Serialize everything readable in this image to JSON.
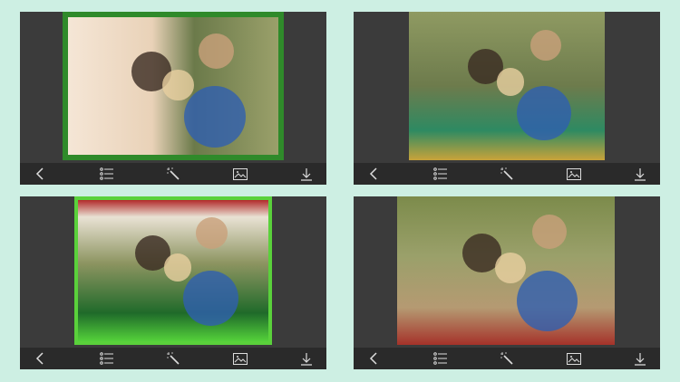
{
  "screens": [
    {
      "frame": "christmas-ornaments-tinsel-frame"
    },
    {
      "frame": "christmas-baubles-overlay"
    },
    {
      "frame": "green-ribbon-bow-frame"
    },
    {
      "frame": "christmas-decorations-border"
    }
  ],
  "toolbar": {
    "icons": [
      "back-icon",
      "list-icon",
      "magic-wand-icon",
      "gallery-icon",
      "download-icon"
    ]
  },
  "colors": {
    "background": "#cdefe3",
    "panel": "#3b3b3b",
    "toolbar": "#2a2a2a"
  }
}
